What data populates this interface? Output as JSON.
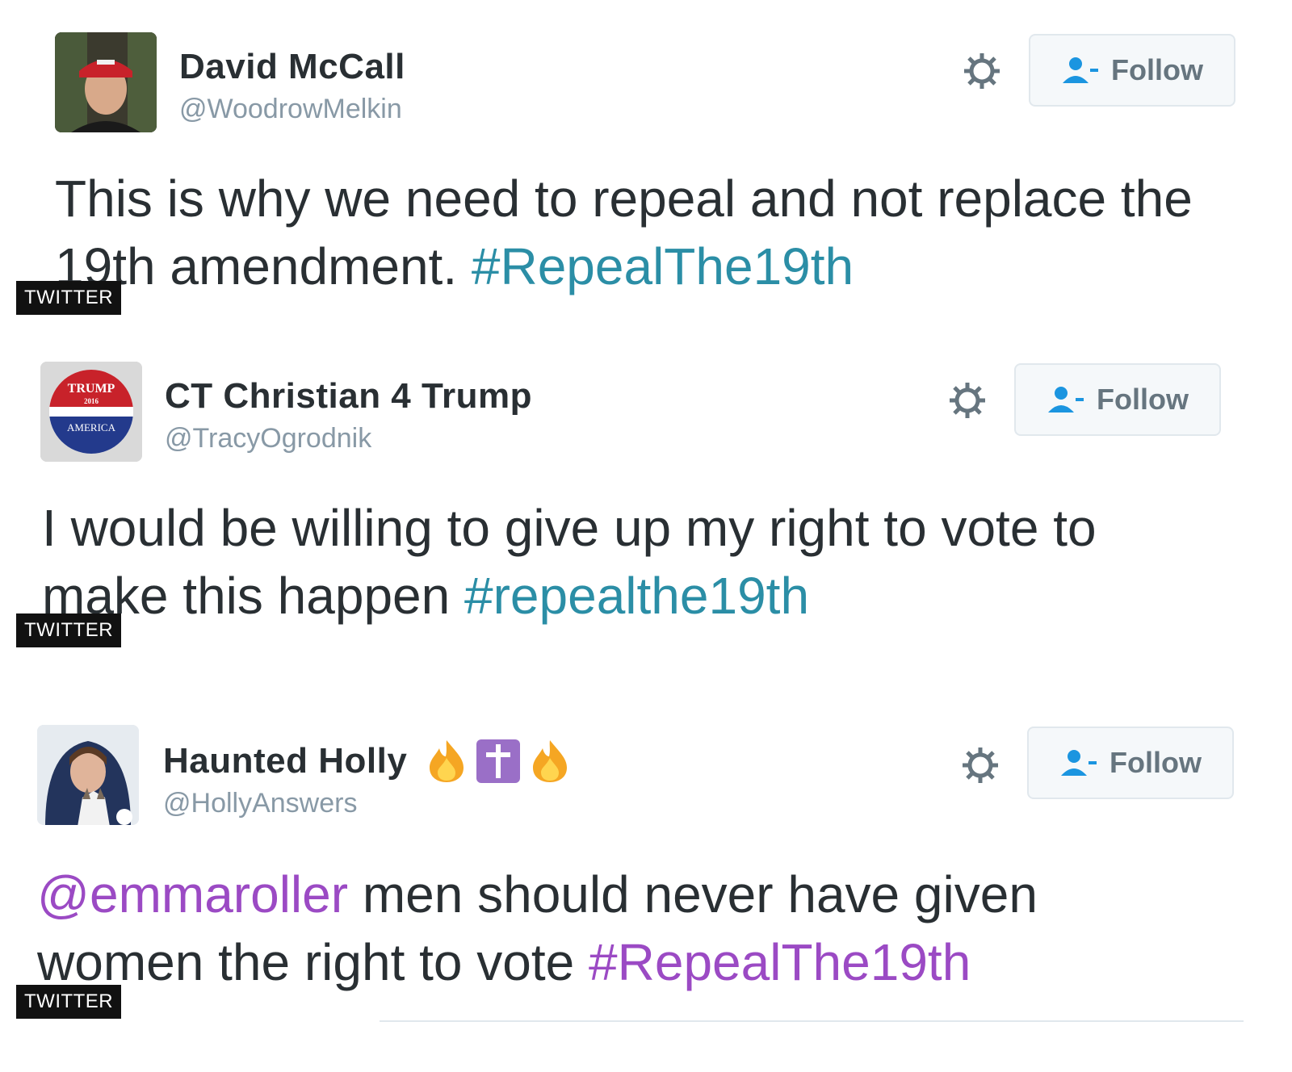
{
  "tweets": [
    {
      "name": "David McCall",
      "handle": "@WoodrowMelkin",
      "follow_label": "Follow",
      "text": "This is why we need to repeal and not replace the 19th amendment.",
      "hashtag": "#RepealThe19th",
      "source": "TWITTER"
    },
    {
      "name": "CT Christian 4 Trump",
      "handle": "@TracyOgrodnik",
      "follow_label": "Follow",
      "text": "I would be willing to give up my right to vote to make this happen",
      "hashtag": "#repealthe19th",
      "source": "TWITTER",
      "avatar_text": {
        "top": "TRUMP",
        "year": "2016",
        "bottom": "AMERICA"
      }
    },
    {
      "name": "Haunted Holly",
      "handle": "@HollyAnswers",
      "follow_label": "Follow",
      "mention": "@emmaroller",
      "text": "men should never have given women the right to vote",
      "hashtag": "#RepealThe19th",
      "source": "TWITTER",
      "name_emojis": [
        "fire-emoji",
        "cross-emoji",
        "fire-emoji"
      ]
    }
  ],
  "colors": {
    "hashtag_blue": "#2b8ea6",
    "mention_purple": "#9b4ac4",
    "handle_gray": "#8899a6",
    "follow_text": "#66757f"
  }
}
